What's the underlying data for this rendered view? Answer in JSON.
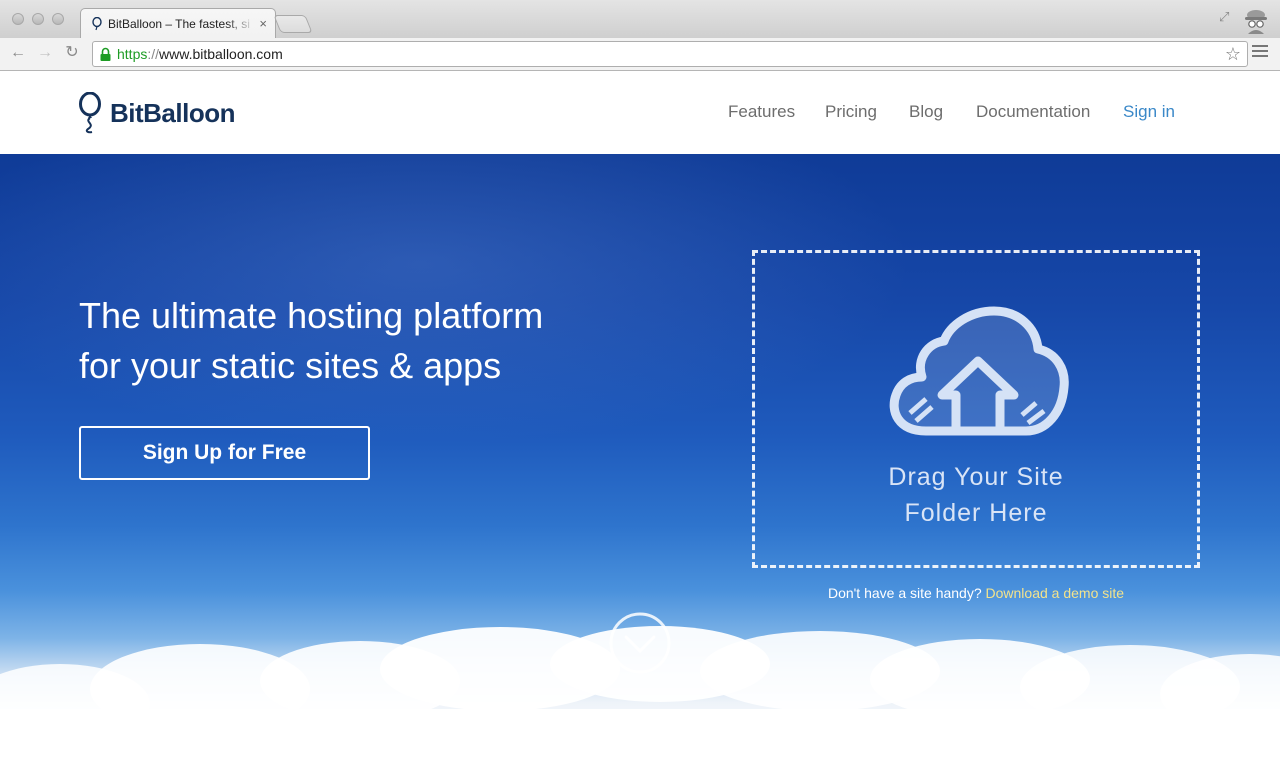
{
  "browser": {
    "tab_title": "BitBalloon – The fastest, si",
    "tab_close": "×",
    "url_scheme": "https",
    "url_sep": "://",
    "url_rest": "www.bitballoon.com",
    "icons": [
      "back-icon",
      "forward-icon",
      "reload-icon",
      "lock-icon",
      "bookmark-star-icon",
      "menu-icon",
      "fullscreen-icon",
      "incognito-icon"
    ]
  },
  "header": {
    "logo_text": "BitBalloon",
    "nav": [
      "Features",
      "Pricing",
      "Blog",
      "Documentation",
      "Sign in"
    ]
  },
  "hero": {
    "title_line1": "The ultimate hosting platform",
    "title_line2": "for your static sites & apps",
    "signup_label": "Sign Up for Free",
    "drop_line1": "Drag Your Site",
    "drop_line2": "Folder Here",
    "demo_prefix": "Don't have a site handy?",
    "demo_link": "Download a demo site"
  },
  "colors": {
    "brand": "#15325a",
    "sign_in": "#3a88c8",
    "demo_link": "#f3e38c",
    "hero_top": "#0f3b97"
  }
}
